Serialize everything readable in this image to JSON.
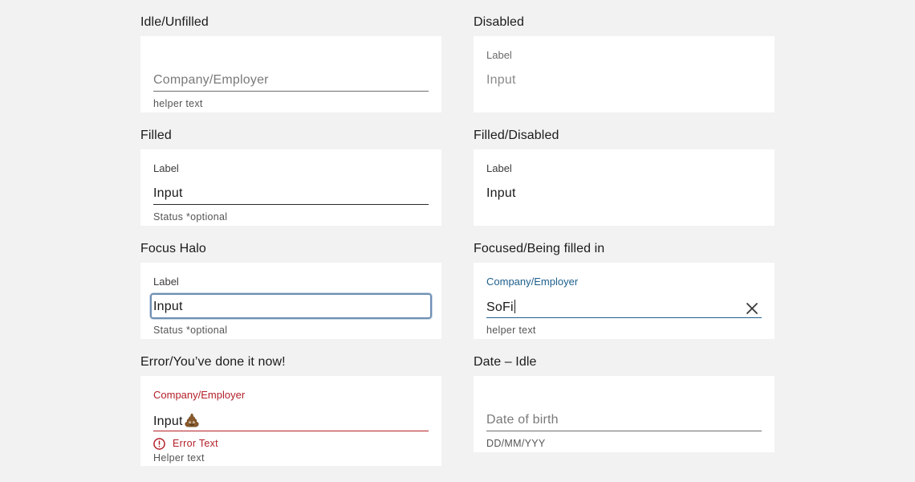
{
  "colors": {
    "page_background": "#f2f2f2",
    "card_background": "#ffffff",
    "focus_accent": "#1e5f8c",
    "error": "#b3202a",
    "halo": "#6e8fb3"
  },
  "idle_unfilled": {
    "title": "Idle/Unfilled",
    "placeholder": "Company/Employer",
    "helper": "helper text"
  },
  "disabled": {
    "title": "Disabled",
    "label": "Label",
    "value": "Input"
  },
  "filled": {
    "title": "Filled",
    "label": "Label",
    "value": "Input",
    "helper": "Status *optional"
  },
  "filled_disabled": {
    "title": "Filled/Disabled",
    "label": "Label",
    "value": "Input"
  },
  "focus_halo": {
    "title": "Focus Halo",
    "label": "Label",
    "value": "Input",
    "helper": "Status *optional"
  },
  "focused_filling": {
    "title": "Focused/Being filled in",
    "label": "Company/Employer",
    "value": "SoFi",
    "helper": "helper text",
    "clear_icon": "close-icon"
  },
  "error": {
    "title": "Error/You’ve done it now!",
    "label": "Company/Employer",
    "value": "Input",
    "value_icon": "pile-of-poo-icon",
    "error_icon": "alert-circle-icon",
    "error_text": "Error Text",
    "helper": "Helper text"
  },
  "date_idle": {
    "title": "Date – Idle",
    "placeholder": "Date of birth",
    "format_hint": "DD/MM/YYY"
  }
}
